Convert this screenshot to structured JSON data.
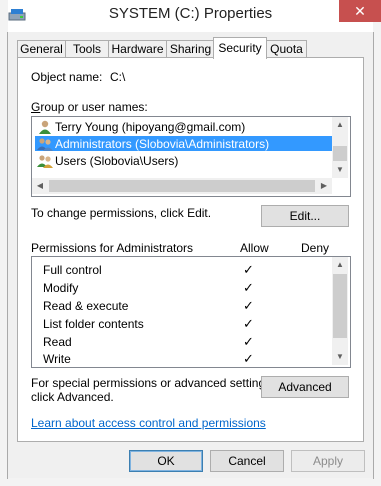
{
  "window": {
    "title": "SYSTEM (C:) Properties",
    "close_glyph": "✕"
  },
  "tabs": [
    {
      "label": "General"
    },
    {
      "label": "Tools"
    },
    {
      "label": "Hardware"
    },
    {
      "label": "Sharing"
    },
    {
      "label": "Security",
      "selected": true
    },
    {
      "label": "Quota"
    }
  ],
  "security": {
    "object_name_label": "Object name:",
    "object_name_value": "C:\\",
    "group_label": "Group or user names:",
    "users": [
      {
        "name": "Terry Young (hipoyang@gmail.com)",
        "icon": "user-icon"
      },
      {
        "name": "Administrators (Slobovia\\Administrators)",
        "icon": "group-icon",
        "selected": true
      },
      {
        "name": "Users (Slobovia\\Users)",
        "icon": "group-icon"
      }
    ],
    "change_hint": "To change permissions, click Edit.",
    "edit_label": "Edit...",
    "permissions_label": "Permissions for Administrators",
    "allow_header": "Allow",
    "deny_header": "Deny",
    "permissions": [
      {
        "name": "Full control",
        "allow": "✓",
        "deny": ""
      },
      {
        "name": "Modify",
        "allow": "✓",
        "deny": ""
      },
      {
        "name": "Read & execute",
        "allow": "✓",
        "deny": ""
      },
      {
        "name": "List folder contents",
        "allow": "✓",
        "deny": ""
      },
      {
        "name": "Read",
        "allow": "✓",
        "deny": ""
      },
      {
        "name": "Write",
        "allow": "✓",
        "deny": ""
      }
    ],
    "special_hint_line1": "For special permissions or advanced settings,",
    "special_hint_line2": "click Advanced.",
    "advanced_label": "Advanced",
    "learn_link": "Learn about access control and permissions"
  },
  "footer": {
    "ok_label": "OK",
    "cancel_label": "Cancel",
    "apply_label": "Apply"
  },
  "colors": {
    "selection": "#3399ff",
    "link": "#0066cc",
    "close_button": "#c7504f"
  }
}
